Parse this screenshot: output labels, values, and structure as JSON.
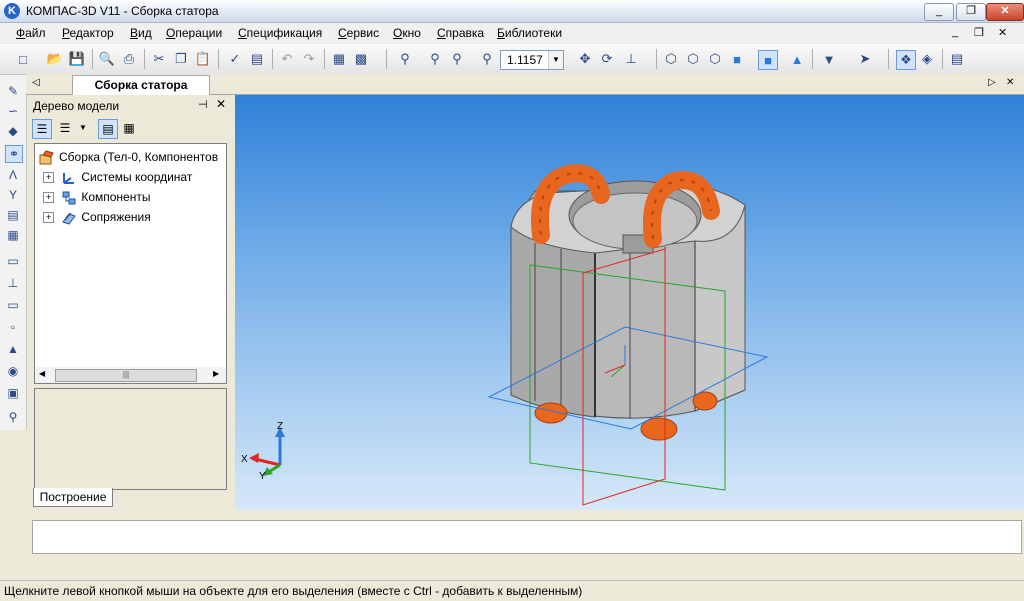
{
  "window": {
    "app_icon_letter": "K",
    "title": "КОМПАС-3D V11 - Сборка статора",
    "minimize": "_",
    "maximize": "❐",
    "close": "✕"
  },
  "menu": {
    "items": [
      {
        "label": "Файл",
        "accel": "Ф"
      },
      {
        "label": "Редактор",
        "accel": "Р"
      },
      {
        "label": "Вид",
        "accel": "В"
      },
      {
        "label": "Операции",
        "accel": "О"
      },
      {
        "label": "Спецификация",
        "accel": "С"
      },
      {
        "label": "Сервис",
        "accel": "С"
      },
      {
        "label": "Окно",
        "accel": "О"
      },
      {
        "label": "Справка",
        "accel": "С"
      },
      {
        "label": "Библиотеки",
        "accel": "Б"
      }
    ],
    "mdi_minimize": "_",
    "mdi_restore": "❐",
    "mdi_close": "✕"
  },
  "toolbar": {
    "zoom_value": "1.1157",
    "zoom_arrow": "▼",
    "icons": [
      "new-icon",
      "open-icon",
      "save-icon",
      "print-preview-icon",
      "print-icon",
      "cut-icon",
      "copy-icon",
      "paste-icon",
      "format-icon",
      "properties-icon",
      "undo-icon",
      "redo-icon",
      "manager-icon",
      "variables-icon",
      "zoom-window-icon",
      "zoom-in-icon",
      "zoom-out-icon",
      "zoom-scale-icon",
      "pan-icon",
      "rotate-icon",
      "orientation-icon",
      "wireframe-icon",
      "hidden-lines-icon",
      "tangent-edges-icon",
      "shaded-icon",
      "shaded-edges-icon",
      "perspective-icon",
      "filter-icon",
      "select-icon",
      "snap-icon",
      "section-icon",
      "layers-icon"
    ]
  },
  "document_tab": {
    "label": "Сборка статора",
    "left_arrow": "◁",
    "right_arrow": "▷",
    "close": "✕"
  },
  "tree": {
    "header": "Дерево модели",
    "pin": "⊣",
    "close": "✕",
    "root": "Сборка (Тел-0, Компонентов",
    "items": [
      {
        "label": "Системы координат",
        "expander": "+"
      },
      {
        "label": "Компоненты",
        "expander": "+"
      },
      {
        "label": "Сопряжения",
        "expander": "+"
      }
    ],
    "scroll_left": "◀",
    "scroll_right": "▶",
    "scroll_grip": "|||",
    "bottom_tab": "Построение"
  },
  "axes": {
    "x": "X",
    "y": "Y",
    "z": "Z"
  },
  "status": {
    "text": "Щелкните левой кнопкой мыши на объекте для его выделения (вместе с Ctrl - добавить к выделенным)"
  },
  "colors": {
    "stator": "#b9b9b9",
    "coil": "#e8661e",
    "x_axis": "#e3251f",
    "y_axis": "#2aa52a",
    "z_axis": "#2a7ad9"
  }
}
